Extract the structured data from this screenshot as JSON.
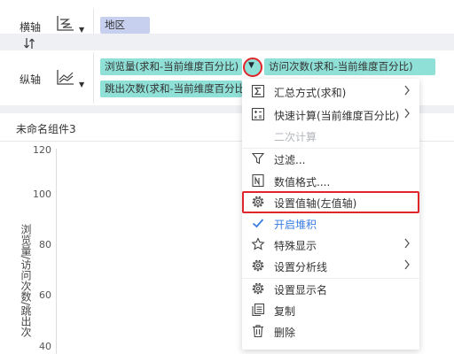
{
  "x_axis": {
    "label": "横轴",
    "chart_icon": "line-chart-zigzag-icon",
    "caret_icon": "caret-down-icon",
    "field": "地区"
  },
  "swap_icon": "swap-axes-icon",
  "y_axis": {
    "label": "纵轴",
    "chart_icon": "line-chart-icon",
    "caret_icon": "caret-down-icon",
    "fields": [
      "浏览量(求和-当前维度百分比)",
      "访问次数(求和-当前维度百分比)",
      "跳出次数(求和-当前维度百分比)"
    ]
  },
  "chart": {
    "title": "未命名组件3",
    "y_axis_title": "浏览量/访问次数/跳出次",
    "y_ticks": [
      "120",
      "100",
      "80",
      "60",
      "40"
    ]
  },
  "context_menu": {
    "items": [
      {
        "label": "汇总方式(求和)",
        "icon": "sigma-icon",
        "has_submenu": true
      },
      {
        "label": "快速计算(当前维度百分比)",
        "icon": "calculator-icon",
        "has_submenu": true
      },
      {
        "label": "二次计算",
        "icon": "",
        "disabled": true
      },
      {
        "label": "过滤...",
        "icon": "filter-icon"
      },
      {
        "label": "数值格式....",
        "icon": "number-format-icon"
      },
      {
        "label": "设置值轴(左值轴)",
        "icon": "gear-icon",
        "highlighted": true
      },
      {
        "label": "开启堆积",
        "icon": "checkmark-icon",
        "checked": true
      },
      {
        "label": "特殊显示",
        "icon": "star-icon",
        "has_submenu": true
      },
      {
        "label": "设置分析线",
        "icon": "analysis-line-gear-icon",
        "has_submenu": true
      },
      {
        "label": "设置显示名",
        "icon": "gear-icon"
      },
      {
        "label": "复制",
        "icon": "copy-icon"
      },
      {
        "label": "删除",
        "icon": "trash-icon"
      }
    ]
  },
  "colors": {
    "dimension_pill": "#c7d0ef",
    "measure_pill": "#8fe0d7",
    "highlight_red": "#e0252b",
    "checked_blue": "#3a7de1"
  }
}
